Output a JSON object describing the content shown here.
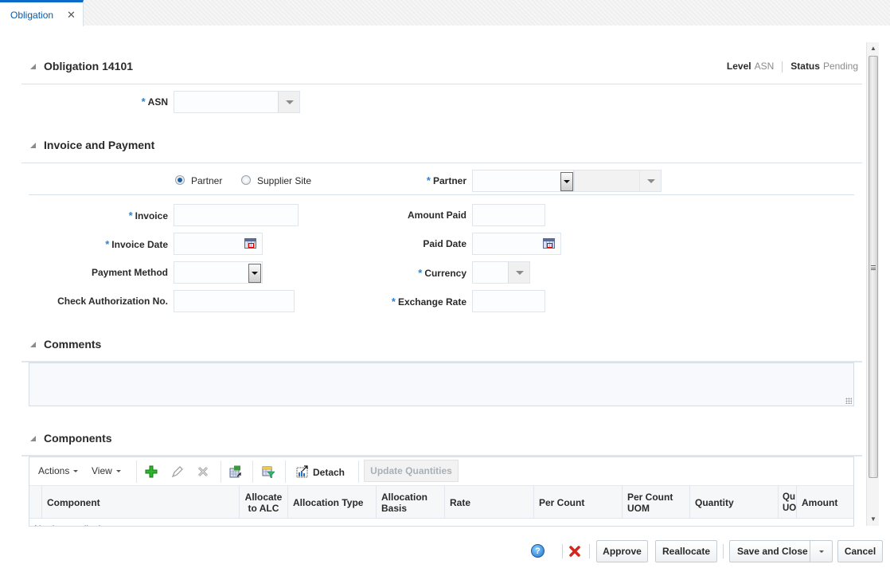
{
  "tabs": [
    {
      "label": "Obligation",
      "close_icon": "close-icon"
    }
  ],
  "header": {
    "title": "Obligation 14101",
    "level_label": "Level",
    "level_value": "ASN",
    "status_label": "Status",
    "status_value": "Pending"
  },
  "asn": {
    "label": "ASN",
    "required": true,
    "value": ""
  },
  "invoice_payment": {
    "title": "Invoice and Payment",
    "radio": {
      "options": [
        "Partner",
        "Supplier Site"
      ],
      "selected": "Partner"
    },
    "partner": {
      "label": "Partner",
      "required": true,
      "value": "",
      "secondary_value": ""
    },
    "invoice": {
      "label": "Invoice",
      "required": true,
      "value": ""
    },
    "invoice_date": {
      "label": "Invoice Date",
      "required": true,
      "value": ""
    },
    "payment_method": {
      "label": "Payment Method",
      "value": ""
    },
    "check_auth": {
      "label": "Check Authorization No.",
      "value": ""
    },
    "amount_paid": {
      "label": "Amount Paid",
      "value": ""
    },
    "paid_date": {
      "label": "Paid Date",
      "value": ""
    },
    "currency": {
      "label": "Currency",
      "required": true,
      "value": ""
    },
    "exchange_rate": {
      "label": "Exchange Rate",
      "required": true,
      "value": ""
    }
  },
  "comments": {
    "title": "Comments",
    "value": ""
  },
  "components": {
    "title": "Components",
    "toolbar": {
      "actions": "Actions",
      "view": "View",
      "icons": [
        "add-icon",
        "edit-icon",
        "delete-icon",
        "export-excel-icon",
        "query-filter-icon"
      ],
      "detach": "Detach",
      "update_quantities": "Update Quantities"
    },
    "columns": [
      "Component",
      "Allocate to ALC",
      "Allocation Type",
      "Allocation Basis",
      "Rate",
      "Per Count",
      "Per Count UOM",
      "Quantity",
      "Qu UO",
      "Amount"
    ],
    "no_data": "No data to display."
  },
  "footer": {
    "help": "?",
    "approve": "Approve",
    "reallocate": "Reallocate",
    "save_and_close": "Save and Close",
    "cancel": "Cancel"
  }
}
